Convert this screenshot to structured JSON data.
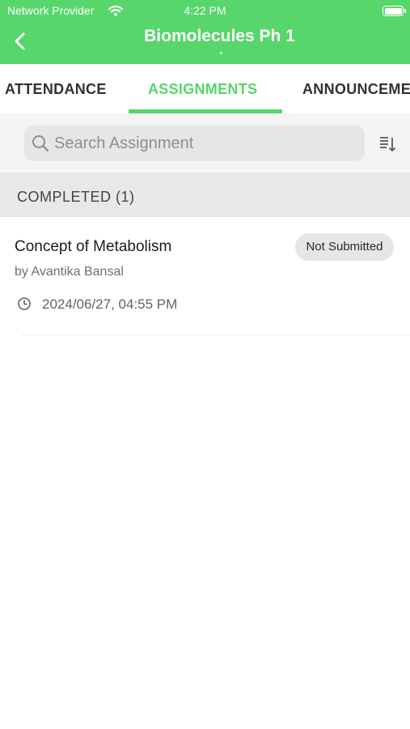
{
  "status_bar": {
    "carrier": "Network Provider",
    "time": "4:22 PM"
  },
  "nav": {
    "title": "Biomolecules Ph 1"
  },
  "tabs": [
    {
      "label": "ATTENDANCE",
      "active": false
    },
    {
      "label": "ASSIGNMENTS",
      "active": true
    },
    {
      "label": "ANNOUNCEMENTS",
      "active": false
    }
  ],
  "search": {
    "placeholder": "Search Assignment",
    "value": ""
  },
  "section": {
    "title": "COMPLETED (1)"
  },
  "assignments": [
    {
      "title": "Concept of Metabolism",
      "author": "by Avantika Bansal",
      "due": "2024/06/27, 04:55 PM",
      "status": "Not Submitted"
    }
  ],
  "colors": {
    "accent": "#56d66b",
    "tab_text": "#2e3238",
    "section_bg": "#e8e8e9",
    "badge_bg": "#e6e6e7"
  },
  "icons": {
    "back": "chevron-left-icon",
    "wifi": "wifi-icon",
    "battery": "battery-icon",
    "search": "search-icon",
    "sort": "sort-icon",
    "clock": "clock-icon"
  }
}
